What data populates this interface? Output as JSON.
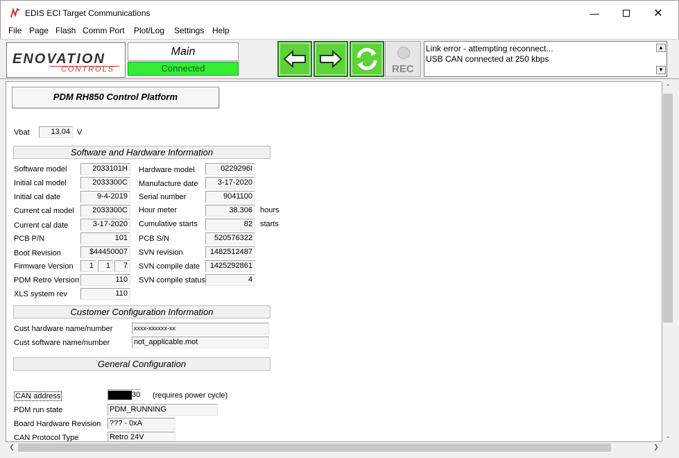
{
  "window": {
    "title": "EDIS ECI Target Communications"
  },
  "menu": [
    "File",
    "Page",
    "Flash",
    "Comm Port",
    "Plot/Log",
    "Settings",
    "Help"
  ],
  "toolbar": {
    "logo_text_main": "ENOVATION",
    "logo_text_sub": "CONTROLS",
    "page_name": "Main",
    "connection_status": "Connected",
    "rec_label": "REC",
    "log": [
      "Link error - attempting reconnect...",
      "USB CAN connected at 250 kbps"
    ],
    "colors": {
      "connected": "#33ee33",
      "nav_button": "#5fd13a"
    }
  },
  "panel": {
    "title": "PDM RH850 Control Platform",
    "vbat": {
      "label": "Vbat",
      "value": "13.04",
      "unit": "V"
    },
    "sections": {
      "sw_hw": "Software and Hardware Information",
      "customer": "Customer Configuration Information",
      "general": "General Configuration"
    },
    "left_fields": [
      {
        "label": "Software model",
        "value": "2033101H"
      },
      {
        "label": "Initial cal model",
        "value": "2033300C"
      },
      {
        "label": "Initial cal date",
        "value": "9-4-2019"
      },
      {
        "label": "Current cal model",
        "value": "2033300C"
      },
      {
        "label": "Current cal date",
        "value": "3-17-2020"
      },
      {
        "label": "PCB P/N",
        "value": "101"
      },
      {
        "label": "Boot Revision",
        "value": "$44450007"
      },
      {
        "label": "Firmware Version",
        "value": ""
      },
      {
        "label": "PDM Retro Version",
        "value": "110"
      },
      {
        "label": "XLS system rev",
        "value": "110"
      }
    ],
    "firmware_version": [
      "1",
      "1",
      "7"
    ],
    "right_fields": [
      {
        "label": "Hardware model",
        "value": "0229296I",
        "unit": ""
      },
      {
        "label": "Manufacture date",
        "value": "3-17-2020",
        "unit": ""
      },
      {
        "label": "Serial number",
        "value": "9041100",
        "unit": ""
      },
      {
        "label": "Hour meter",
        "value": "38.306",
        "unit": "hours"
      },
      {
        "label": "Cumulative starts",
        "value": "82",
        "unit": "starts"
      },
      {
        "label": "PCB S/N",
        "value": "520576322",
        "unit": ""
      },
      {
        "label": "SVN revision",
        "value": "1482512487",
        "unit": ""
      },
      {
        "label": "SVN compile date",
        "value": "1425292861",
        "unit": ""
      },
      {
        "label": "SVN compile status",
        "value": "4",
        "unit": ""
      }
    ],
    "customer_fields": [
      {
        "label": "Cust hardware name/number",
        "value": "xxxx-xxxxxx-xx"
      },
      {
        "label": "Cust software name/number",
        "value": "not_applicable.mot"
      }
    ],
    "general_fields": [
      {
        "label": "CAN address",
        "value": "30",
        "note": "(requires power cycle)"
      },
      {
        "label": "PDM run state",
        "value": "PDM_RUNNING"
      },
      {
        "label": "Board Hardware Revision",
        "value": "??? - 0xA"
      },
      {
        "label": "CAN Protocol Type",
        "value": "Retro 24V"
      }
    ]
  }
}
